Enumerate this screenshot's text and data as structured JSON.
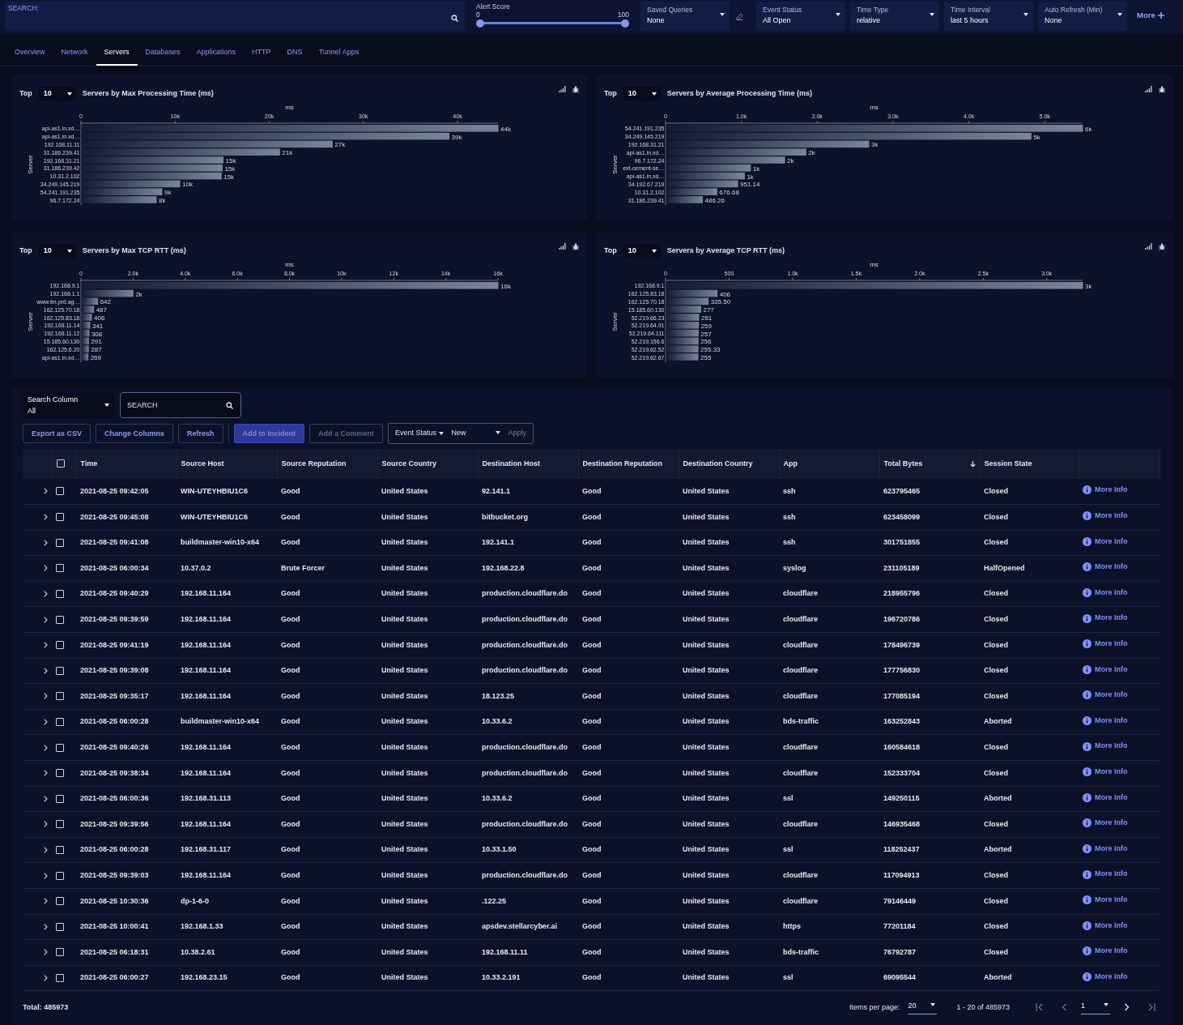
{
  "topbar": {
    "search": {
      "label": "SEARCH:"
    },
    "slider": {
      "label": "Alert Score",
      "min_label": "0",
      "max_label": "100",
      "level": 1
    },
    "dropdowns": [
      {
        "label": "Saved Queries",
        "value": "None",
        "edit": true
      },
      {
        "label": "Event Status",
        "value": "All Open",
        "edit": false
      },
      {
        "label": "Time Type",
        "value": "relative",
        "edit": false
      },
      {
        "label": "Time Interval",
        "value": "last 5 hours",
        "edit": false
      },
      {
        "label": "Auto Refresh (Min)",
        "value": "None",
        "edit": false
      }
    ],
    "more": "More"
  },
  "tabs": [
    {
      "label": "Overview",
      "selected": false
    },
    {
      "label": "Network",
      "selected": false
    },
    {
      "label": "Servers",
      "selected": true
    },
    {
      "label": "Databases",
      "selected": false
    },
    {
      "label": "Applications",
      "selected": false
    },
    {
      "label": "HTTP",
      "selected": false
    },
    {
      "label": "DNS",
      "selected": false
    },
    {
      "label": "Tunnel Apps",
      "selected": false
    }
  ],
  "charts": [
    {
      "top_label": "Top",
      "top_value": "10",
      "chart_data": {
        "type": "bar",
        "orientation": "horizontal",
        "title": "Servers by Max Processing Time (ms)",
        "xlabel": "ms",
        "ylabel": "Server",
        "categories": [
          "api-as1.in.xd…",
          "api-as1.in.xd…",
          "192.168.11.11",
          "31.186.239.41",
          "192.168.31.21",
          "31.186.239.42",
          "10.31.2.102",
          "34.249.145.219",
          "54.241.191.235",
          "96.7.172.24"
        ],
        "values": [
          44300,
          39100,
          26700,
          21100,
          15100,
          15000,
          14900,
          10500,
          8600,
          8000
        ],
        "value_labels": [
          "44k",
          "39k",
          "27k",
          "21k",
          "15k",
          "15k",
          "15k",
          "10k",
          "9k",
          "8k"
        ],
        "xlim": [
          0,
          44300
        ],
        "xticks": [
          {
            "value": 0,
            "label": "0"
          },
          {
            "value": 10000,
            "label": "10k"
          },
          {
            "value": 20000,
            "label": "20k"
          },
          {
            "value": 30000,
            "label": "30k"
          },
          {
            "value": 40000,
            "label": "40k"
          }
        ]
      }
    },
    {
      "top_label": "Top",
      "top_value": "10",
      "chart_data": {
        "type": "bar",
        "orientation": "horizontal",
        "title": "Servers by Average Processing Time (ms)",
        "xlabel": "ms",
        "ylabel": "Server",
        "categories": [
          "54.241.191.235",
          "34.249.145.219",
          "192.168.31.21",
          "api-as1.in.xd…",
          "96.7.172.24",
          "ext-cement-se…",
          "api-as1.in.xd…",
          "34.192.67.219",
          "10.31.2.102",
          "31.186.239.41"
        ],
        "values": [
          5500,
          4820,
          2680,
          1850,
          1570,
          1120,
          1040,
          951.14,
          676.68,
          486.26
        ],
        "value_labels": [
          "6k",
          "5k",
          "3k",
          "2k",
          "2k",
          "1k",
          "1k",
          "951.14",
          "676.68",
          "486.26"
        ],
        "xlim": [
          0,
          5500
        ],
        "xticks": [
          {
            "value": 0,
            "label": "0"
          },
          {
            "value": 1000,
            "label": "1.0k"
          },
          {
            "value": 2000,
            "label": "2.0k"
          },
          {
            "value": 3000,
            "label": "3.0k"
          },
          {
            "value": 4000,
            "label": "4.0k"
          },
          {
            "value": 5000,
            "label": "5.0k"
          }
        ]
      }
    },
    {
      "top_label": "Top",
      "top_value": "10",
      "chart_data": {
        "type": "bar",
        "orientation": "horizontal",
        "title": "Servers by Max TCP RTT (ms)",
        "xlabel": "ms",
        "ylabel": "Server",
        "categories": [
          "192.168.9.1",
          "192.168.1.1",
          "www.tm.prd.ag…",
          "162.125.70.18",
          "162.125.83.18",
          "192.168.11.14",
          "192.168.11.12",
          "15.185.60.130",
          "162.125.6.20",
          "api-as1.in.xd…"
        ],
        "values": [
          16000,
          2000,
          642,
          487,
          406,
          341,
          308,
          291,
          287,
          269
        ],
        "value_labels": [
          "16k",
          "2k",
          "642",
          "487",
          "406",
          "341",
          "308",
          "291",
          "287",
          "269"
        ],
        "xlim": [
          0,
          16000
        ],
        "xticks": [
          {
            "value": 0,
            "label": "0"
          },
          {
            "value": 2000,
            "label": "2.0k"
          },
          {
            "value": 4000,
            "label": "4.0k"
          },
          {
            "value": 6000,
            "label": "6.0k"
          },
          {
            "value": 8000,
            "label": "8.0k"
          },
          {
            "value": 10000,
            "label": "10k"
          },
          {
            "value": 12000,
            "label": "12k"
          },
          {
            "value": 14000,
            "label": "14k"
          },
          {
            "value": 16000,
            "label": "16k"
          }
        ]
      }
    },
    {
      "top_label": "Top",
      "top_value": "10",
      "chart_data": {
        "type": "bar",
        "orientation": "horizontal",
        "title": "Servers by Average TCP RTT (ms)",
        "xlabel": "ms",
        "ylabel": "Server",
        "categories": [
          "192.168.9.1",
          "162.125.83.18",
          "162.125.70.18",
          "15.185.60.130",
          "52.219.66.23",
          "52.219.64.91",
          "52.219.64.111",
          "52.219.156.6",
          "52.219.62.52",
          "52.219.62.67"
        ],
        "values": [
          3282,
          406,
          335.5,
          277,
          261,
          259,
          257,
          256,
          255.33,
          255
        ],
        "value_labels": [
          "3k",
          "406",
          "335.50",
          "277",
          "261",
          "259",
          "257",
          "256",
          "255.33",
          "255"
        ],
        "xlim": [
          0,
          3282
        ],
        "xticks": [
          {
            "value": 0,
            "label": "0"
          },
          {
            "value": 500,
            "label": "500"
          },
          {
            "value": 1000,
            "label": "1.0k"
          },
          {
            "value": 1500,
            "label": "1.5k"
          },
          {
            "value": 2000,
            "label": "2.0k"
          },
          {
            "value": 2500,
            "label": "2.5k"
          },
          {
            "value": 3000,
            "label": "3.0k"
          }
        ]
      }
    }
  ],
  "table_tools": {
    "search_column": {
      "label": "Search Column",
      "value": "All"
    },
    "search": {
      "placeholder": "SEARCH"
    },
    "buttons": [
      {
        "label": "Export as CSV",
        "kind": "outline",
        "disabled": false
      },
      {
        "label": "Change Columns",
        "kind": "outline",
        "disabled": false
      },
      {
        "label": "Refresh",
        "kind": "outline",
        "disabled": false
      },
      {
        "label": "Add to Incident",
        "kind": "primary",
        "disabled": true
      },
      {
        "label": "Add a Comment",
        "kind": "outline",
        "disabled": true
      }
    ],
    "status_group": {
      "menu": "Event Status",
      "value": "New",
      "apply": "Apply",
      "apply_disabled": true
    }
  },
  "table": {
    "header_checked": false,
    "columns": [
      {
        "label": "Time",
        "sort_desc": false
      },
      {
        "label": "Source Host",
        "sort_desc": false
      },
      {
        "label": "Source Reputation",
        "sort_desc": false
      },
      {
        "label": "Source Country",
        "sort_desc": false
      },
      {
        "label": "Destination Host",
        "sort_desc": false
      },
      {
        "label": "Destination Reputation",
        "sort_desc": false
      },
      {
        "label": "Destination Country",
        "sort_desc": false
      },
      {
        "label": "App",
        "sort_desc": false
      },
      {
        "label": "Total Bytes",
        "sort_desc": true
      },
      {
        "label": "Session State",
        "sort_desc": false
      }
    ],
    "rows": [
      {
        "checked": false,
        "link": "More Info",
        "cells": [
          "2021-08-25 09:42:05",
          "WIN-UTEYHBIU1C6",
          "Good",
          "United States",
          "92.141.1",
          "Good",
          "United States",
          "ssh",
          "623795465",
          "Closed"
        ]
      },
      {
        "checked": false,
        "link": "More Info",
        "cells": [
          "2021-08-25 09:45:08",
          "WIN-UTEYHBIU1C6",
          "Good",
          "United States",
          "bitbucket.org",
          "Good",
          "United States",
          "ssh",
          "623458099",
          "Closed"
        ]
      },
      {
        "checked": false,
        "link": "More Info",
        "cells": [
          "2021-08-25 09:41:08",
          "buildmaster-win10-x64",
          "Good",
          "United States",
          "192.141.1",
          "Good",
          "United States",
          "ssh",
          "301751855",
          "Closed"
        ]
      },
      {
        "checked": false,
        "link": "More Info",
        "cells": [
          "2021-08-25 06:00:34",
          "10.37.0.2",
          "Brute Forcer",
          "United States",
          "192.168.22.8",
          "Good",
          "United States",
          "syslog",
          "231105189",
          "HalfOpened"
        ]
      },
      {
        "checked": false,
        "link": "More Info",
        "cells": [
          "2021-08-25 09:40:29",
          "192.168.11.164",
          "Good",
          "United States",
          "production.cloudflare.do",
          "Good",
          "United States",
          "cloudflare",
          "218955796",
          "Closed"
        ]
      },
      {
        "checked": false,
        "link": "More Info",
        "cells": [
          "2021-08-25 09:39:59",
          "192.168.11.164",
          "Good",
          "United States",
          "production.cloudflare.do",
          "Good",
          "United States",
          "cloudflare",
          "196720786",
          "Closed"
        ]
      },
      {
        "checked": false,
        "link": "More Info",
        "cells": [
          "2021-08-25 09:41:19",
          "192.168.11.164",
          "Good",
          "United States",
          "production.cloudflare.do",
          "Good",
          "United States",
          "cloudflare",
          "178496739",
          "Closed"
        ]
      },
      {
        "checked": false,
        "link": "More Info",
        "cells": [
          "2021-08-25 09:39:08",
          "192.168.11.164",
          "Good",
          "United States",
          "production.cloudflare.do",
          "Good",
          "United States",
          "cloudflare",
          "177756830",
          "Closed"
        ]
      },
      {
        "checked": false,
        "link": "More Info",
        "cells": [
          "2021-08-25 09:35:17",
          "192.168.11.164",
          "Good",
          "United States",
          "18.123.25",
          "Good",
          "United States",
          "cloudflare",
          "177085194",
          "Closed"
        ]
      },
      {
        "checked": false,
        "link": "More Info",
        "cells": [
          "2021-08-25 06:00:28",
          "buildmaster-win10-x64",
          "Good",
          "United States",
          "10.33.6.2",
          "Good",
          "United States",
          "bds-traffic",
          "163252843",
          "Aborted"
        ]
      },
      {
        "checked": false,
        "link": "More Info",
        "cells": [
          "2021-08-25 09:40:26",
          "192.168.11.164",
          "Good",
          "United States",
          "production.cloudflare.do",
          "Good",
          "United States",
          "cloudflare",
          "160584618",
          "Closed"
        ]
      },
      {
        "checked": false,
        "link": "More Info",
        "cells": [
          "2021-08-25 09:38:34",
          "192.168.11.164",
          "Good",
          "United States",
          "production.cloudflare.do",
          "Good",
          "United States",
          "cloudflare",
          "152333704",
          "Closed"
        ]
      },
      {
        "checked": false,
        "link": "More Info",
        "cells": [
          "2021-08-25 06:00:36",
          "192.168.31.113",
          "Good",
          "United States",
          "10.33.6.2",
          "Good",
          "United States",
          "ssl",
          "149250115",
          "Aborted"
        ]
      },
      {
        "checked": false,
        "link": "More Info",
        "cells": [
          "2021-08-25 09:39:56",
          "192.168.11.164",
          "Good",
          "United States",
          "production.cloudflare.do",
          "Good",
          "United States",
          "cloudflare",
          "146935468",
          "Closed"
        ]
      },
      {
        "checked": false,
        "link": "More Info",
        "cells": [
          "2021-08-25 06:00:28",
          "192.168.31.117",
          "Good",
          "United States",
          "10.33.1.50",
          "Good",
          "United States",
          "ssl",
          "118252437",
          "Aborted"
        ]
      },
      {
        "checked": false,
        "link": "More Info",
        "cells": [
          "2021-08-25 09:39:03",
          "192.168.11.164",
          "Good",
          "United States",
          "production.cloudflare.do",
          "Good",
          "United States",
          "cloudflare",
          "117094913",
          "Closed"
        ]
      },
      {
        "checked": false,
        "link": "More Info",
        "cells": [
          "2021-08-25 10:30:36",
          "dp-1-6-0",
          "Good",
          "United States",
          ".122.25",
          "Good",
          "United States",
          "cloudflare",
          "79146449",
          "Closed"
        ]
      },
      {
        "checked": false,
        "link": "More Info",
        "cells": [
          "2021-08-25 10:00:41",
          "192.168.1.33",
          "Good",
          "United States",
          "apsdev.stellarcyber.ai",
          "Good",
          "United States",
          "https",
          "77201184",
          "Closed"
        ]
      },
      {
        "checked": false,
        "link": "More Info",
        "cells": [
          "2021-08-25 06:18:31",
          "10.38.2.61",
          "Good",
          "United States",
          "192.168.11.11",
          "Good",
          "United States",
          "bds-traffic",
          "76792787",
          "Closed"
        ]
      },
      {
        "checked": false,
        "link": "More Info",
        "cells": [
          "2021-08-25 06:00:27",
          "192.168.23.15",
          "Good",
          "United States",
          "10.33.2.191",
          "Good",
          "United States",
          "ssl",
          "69095544",
          "Aborted"
        ]
      }
    ]
  },
  "footer": {
    "total": "Total: 485973",
    "items_label": "Items per page:",
    "items_value": "20",
    "range": "1 - 20 of 485973",
    "page": "1",
    "first_disabled": true,
    "prev_disabled": true,
    "next_disabled": false,
    "last_disabled": true
  }
}
